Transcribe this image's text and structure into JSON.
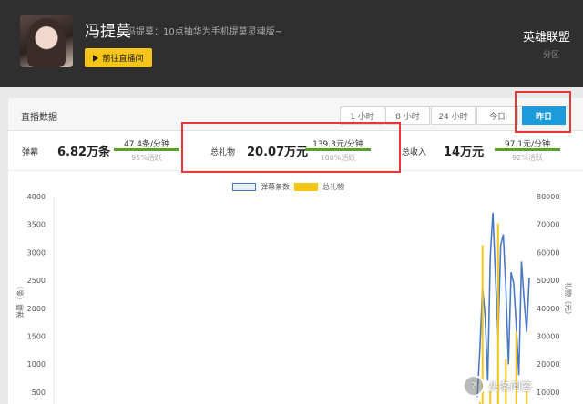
{
  "header": {
    "name": "冯提莫",
    "subtitle": "冯提莫：10点抽华为手机提莫灵魂版~",
    "live_button": "前往直播间",
    "category": "英雄联盟",
    "category_sub": "分区"
  },
  "panel": {
    "title": "直播数据",
    "tabs": [
      "1 小时",
      "8 小时",
      "24 小时",
      "今日",
      "昨日"
    ],
    "active_tab": "昨日"
  },
  "stats": [
    {
      "label": "弹幕",
      "value": "6.82万条",
      "rate": "47.4条/分钟",
      "active": "95%活跃"
    },
    {
      "label": "总礼物",
      "value": "20.07万元",
      "rate": "139.3元/分钟",
      "active": "100%活跃"
    },
    {
      "label": "总收入",
      "value": "14万元",
      "rate": "97.1元/分钟",
      "active": "92%活跃"
    }
  ],
  "colors": {
    "accent_blue": "#1a9bdc",
    "line_blue": "#4a78c4",
    "gift_yellow": "#f5c518",
    "highlight_red": "#e53935",
    "progress_green": "#5aa02c"
  },
  "chart_data": {
    "type": "line",
    "legend": [
      "弹幕条数",
      "总礼物"
    ],
    "ylabel_left": "弹幕（条）",
    "ylabel_right": "礼物（元）",
    "y_left_ticks": [
      "4000",
      "3500",
      "3000",
      "2500",
      "2000",
      "1500",
      "1000",
      "500"
    ],
    "y_right_ticks": [
      "80000",
      "70000",
      "60000",
      "50000",
      "40000",
      "30000",
      "20000",
      "10000"
    ],
    "ylim_left": [
      0,
      4000
    ],
    "ylim_right": [
      0,
      80000
    ],
    "series": [
      {
        "name": "弹幕条数",
        "color": "#4a78c4",
        "values": [
          300,
          1200,
          2300,
          1800,
          600,
          2900,
          3700,
          2500,
          1400,
          3100,
          3300,
          2300,
          900,
          2600,
          2400,
          1600,
          700,
          2800,
          2100,
          1500,
          2500
        ]
      },
      {
        "name": "总礼物",
        "color": "#f5c518",
        "values": [
          0,
          4000,
          62000,
          3000,
          0,
          8000,
          0,
          2000,
          70000,
          1000,
          0,
          20000,
          0,
          3000,
          0,
          30000,
          0,
          2000,
          0,
          8000,
          0
        ]
      }
    ]
  },
  "watermark": "头条问答"
}
